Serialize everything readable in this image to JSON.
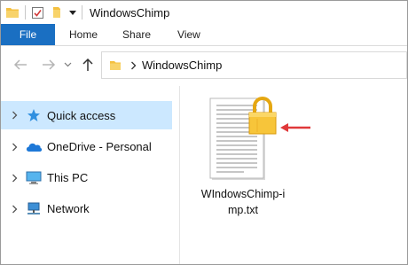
{
  "window": {
    "title": "WindowsChimp"
  },
  "ribbon": {
    "tabs": [
      {
        "label": "File"
      },
      {
        "label": "Home"
      },
      {
        "label": "Share"
      },
      {
        "label": "View"
      }
    ]
  },
  "address": {
    "path": "WindowsChimp"
  },
  "nav_pane": {
    "items": [
      {
        "label": "Quick access",
        "icon": "star-icon",
        "selected": true
      },
      {
        "label": "OneDrive - Personal",
        "icon": "cloud-icon",
        "selected": false
      },
      {
        "label": "This PC",
        "icon": "computer-icon",
        "selected": false
      },
      {
        "label": "Network",
        "icon": "network-icon",
        "selected": false
      }
    ]
  },
  "content": {
    "files": [
      {
        "name_line1": "WIndowsChimp-i",
        "name_line2": "mp.txt",
        "icon": "text-document-icon",
        "overlay": "lock-icon"
      }
    ]
  },
  "colors": {
    "file_tab": "#1a6fc2",
    "selection": "#cce8ff",
    "lock": "#f2b51c",
    "annotation_arrow": "#e0393a"
  }
}
